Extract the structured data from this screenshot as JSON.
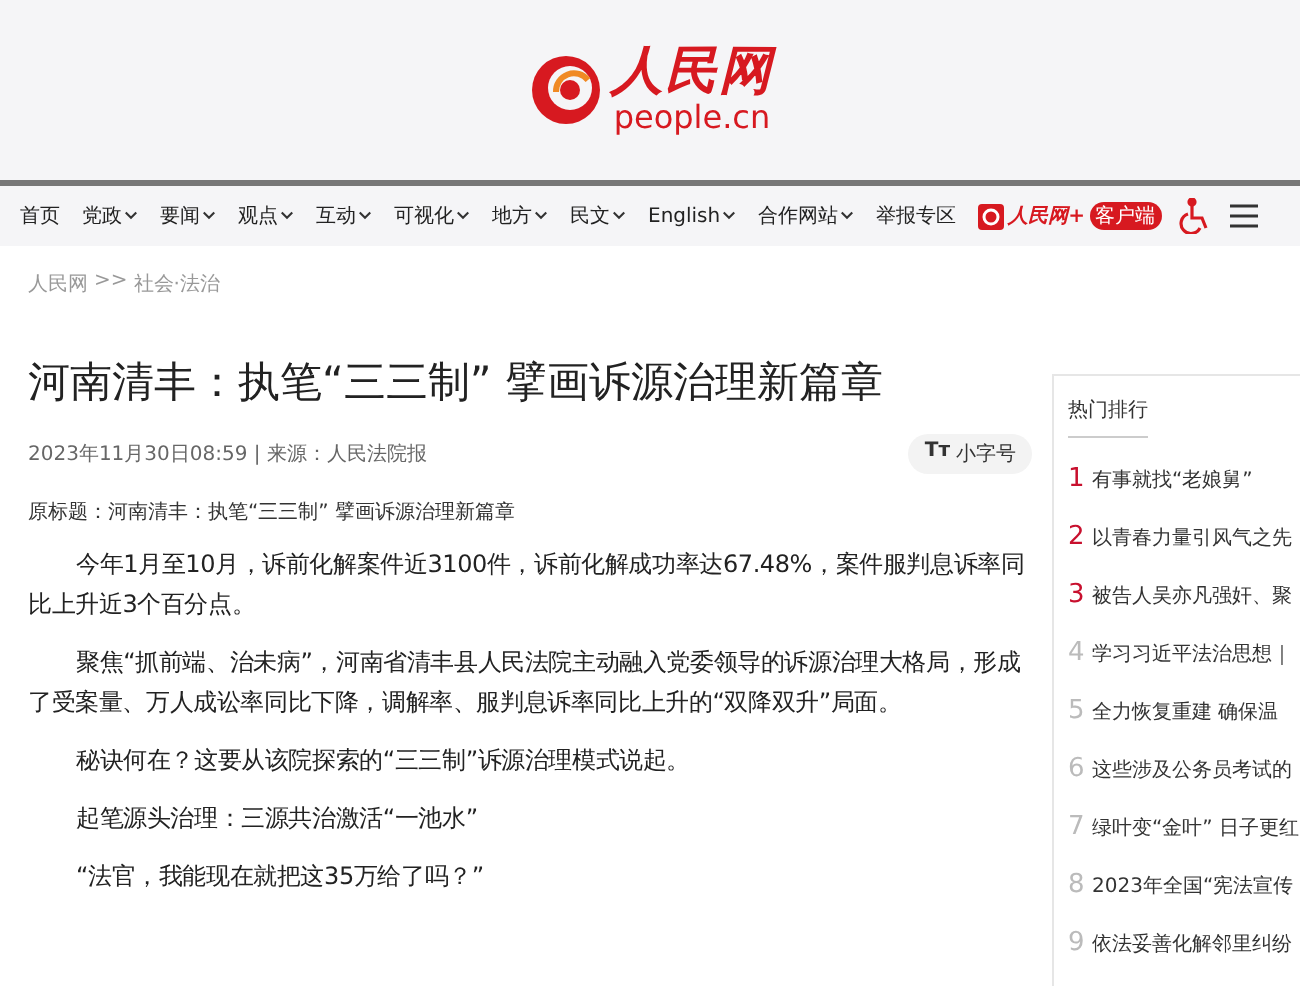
{
  "header": {
    "logo_text": "人民网",
    "logo_domain": "people.cn"
  },
  "nav": {
    "items": [
      {
        "label": "首页",
        "has_menu": false
      },
      {
        "label": "党政",
        "has_menu": true
      },
      {
        "label": "要闻",
        "has_menu": true
      },
      {
        "label": "观点",
        "has_menu": true
      },
      {
        "label": "互动",
        "has_menu": true
      },
      {
        "label": "可视化",
        "has_menu": true
      },
      {
        "label": "地方",
        "has_menu": true
      },
      {
        "label": "民文",
        "has_menu": true
      },
      {
        "label": "English",
        "has_menu": true
      },
      {
        "label": "合作网站",
        "has_menu": true
      },
      {
        "label": "举报专区",
        "has_menu": false
      }
    ],
    "app_name": "人民网+",
    "app_badge": "客户端"
  },
  "breadcrumb": [
    "人民网",
    ">>",
    "社会·法治"
  ],
  "article": {
    "title": "河南清丰：执笔“三三制” 擘画诉源治理新篇章",
    "meta": "2023年11月30日08:59 | 来源：人民法院报",
    "font_button": "小字号",
    "font_button_icon": "Tт",
    "original_title": "原标题：河南清丰：执笔“三三制” 擘画诉源治理新篇章",
    "paragraphs": [
      "今年1月至10月，诉前化解案件近3100件，诉前化解成功率达67.48%，案件服判息诉率同比上升近3个百分点。",
      "聚焦“抓前端、治未病”，河南省清丰县人民法院主动融入党委领导的诉源治理大格局，形成了受案量、万人成讼率同比下降，调解率、服判息诉率同比上升的“双降双升”局面。",
      "秘诀何在？这要从该院探索的“三三制”诉源治理模式说起。",
      "起笔源头治理：三源共治激活“一池水”",
      "“法官，我能现在就把这35万给了吗？”"
    ]
  },
  "sidebar": {
    "title": "热门排行",
    "items": [
      {
        "rank": "1",
        "text": "有事就找“老娘舅”",
        "color": "#c8102e"
      },
      {
        "rank": "2",
        "text": "以青春力量引风气之先",
        "color": "#c8102e"
      },
      {
        "rank": "3",
        "text": "被告人吴亦凡强奸、聚",
        "color": "#c8102e"
      },
      {
        "rank": "4",
        "text": "学习习近平法治思想｜",
        "color": "#bbbbbb"
      },
      {
        "rank": "5",
        "text": "全力恢复重建 确保温",
        "color": "#bbbbbb"
      },
      {
        "rank": "6",
        "text": "这些涉及公务员考试的",
        "color": "#bbbbbb"
      },
      {
        "rank": "7",
        "text": "绿叶变“金叶” 日子更红",
        "color": "#bbbbbb"
      },
      {
        "rank": "8",
        "text": "2023年全国“宪法宣传",
        "color": "#bbbbbb"
      },
      {
        "rank": "9",
        "text": "依法妥善化解邻里纠纷",
        "color": "#bbbbbb"
      }
    ]
  }
}
